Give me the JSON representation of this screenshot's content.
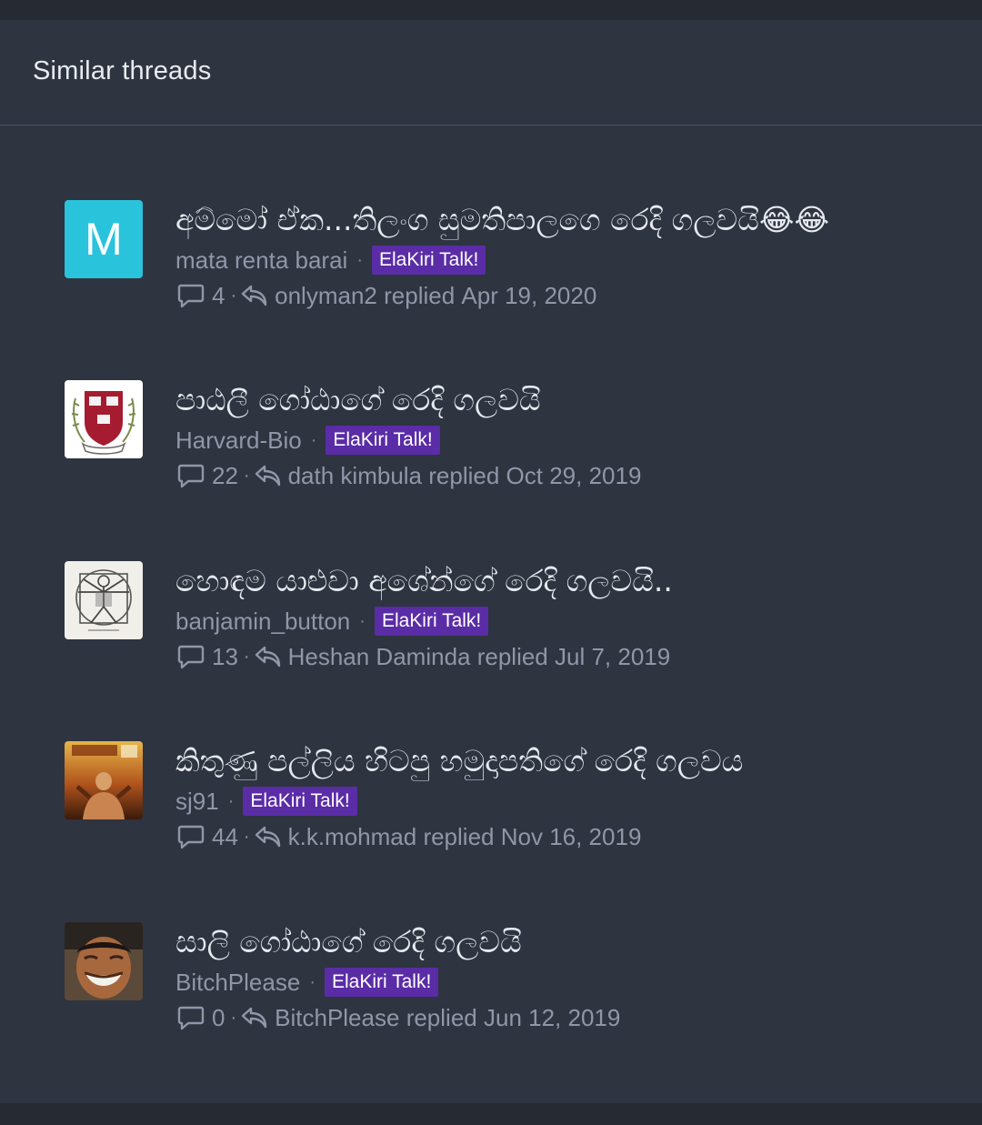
{
  "block_title": "Similar threads",
  "threads": [
    {
      "title": "අම්මෝ ඒක...තිලංග සුමතිපාලගෙ රෙදි ගලවයි😂😂",
      "author": "mata renta barai",
      "prefix": "ElaKiri Talk!",
      "replies": "4",
      "last_poster": "onlyman2",
      "replied_label": "replied",
      "date": "Apr 19, 2020",
      "avatar": {
        "type": "letter",
        "letter": "M",
        "color": "#29c4dc"
      }
    },
    {
      "title": "පාඨලී ගෝඨාගේ රෙදි ගලවයි",
      "author": "Harvard-Bio",
      "prefix": "ElaKiri Talk!",
      "replies": "22",
      "last_poster": "dath kimbula",
      "replied_label": "replied",
      "date": "Oct 29, 2019",
      "avatar": {
        "type": "image",
        "icon": "harvard-crest-icon"
      }
    },
    {
      "title": "හොඳම යාළුවා අශේන්ගේ රෙදි ගලවයි..",
      "author": "banjamin_button",
      "prefix": "ElaKiri Talk!",
      "replies": "13",
      "last_poster": "Heshan Daminda",
      "replied_label": "replied",
      "date": "Jul 7, 2019",
      "avatar": {
        "type": "image",
        "icon": "vitruvian-sketch-icon"
      }
    },
    {
      "title": "කිතුණු පල්ලිය හිටපු හමුදාපතිගේ රෙදි ගලවය",
      "author": "sj91",
      "prefix": "ElaKiri Talk!",
      "replies": "44",
      "last_poster": "k.k.mohmad",
      "replied_label": "replied",
      "date": "Nov 16, 2019",
      "avatar": {
        "type": "image",
        "icon": "movie-poster-icon"
      }
    },
    {
      "title": "සාලි ගෝඨාගේ රෙදි ගලවයි",
      "author": "BitchPlease",
      "prefix": "ElaKiri Talk!",
      "replies": "0",
      "last_poster": "BitchPlease",
      "replied_label": "replied",
      "date": "Jun 12, 2019",
      "avatar": {
        "type": "image",
        "icon": "laughing-man-photo-icon"
      }
    }
  ],
  "colors": {
    "panel": "#2e3440",
    "prefix_bg": "#5a2ca6",
    "muted_text": "#8f97a8",
    "title_text": "#e6e9ef"
  }
}
